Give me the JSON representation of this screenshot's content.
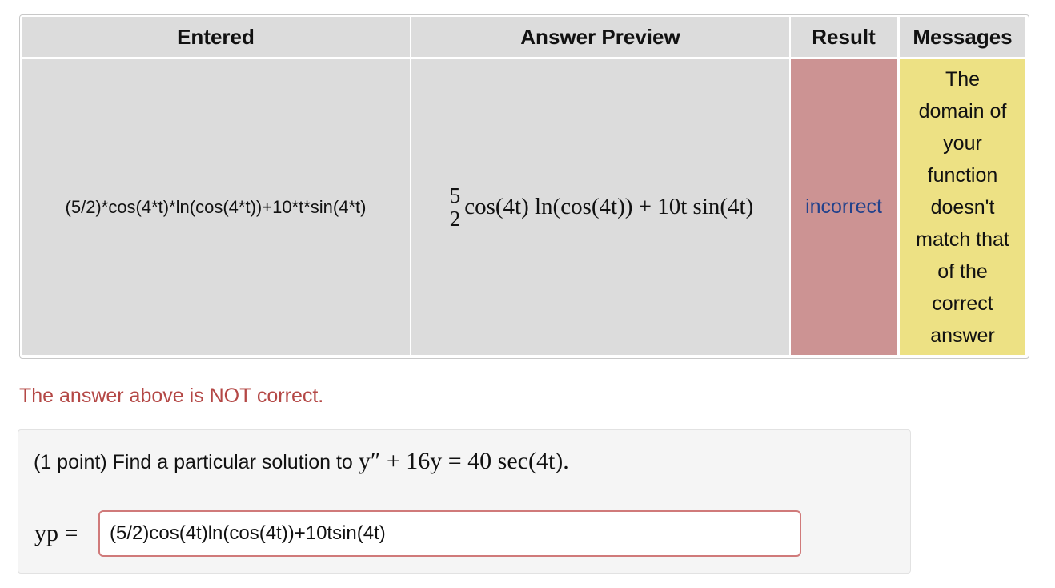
{
  "table": {
    "headers": [
      "Entered",
      "Answer Preview",
      "Result",
      "Messages"
    ],
    "row": {
      "entered": "(5/2)*cos(4*t)*ln(cos(4*t))+10*t*sin(4*t)",
      "preview": {
        "frac_num": "5",
        "frac_den": "2",
        "rest": "cos(4t) ln(cos(4t)) + 10t sin(4t)"
      },
      "result": "incorrect",
      "message_lines": [
        "The",
        "domain of",
        "your",
        "function",
        "doesn't",
        "match that",
        "of the",
        "correct",
        "answer"
      ]
    }
  },
  "status": "The answer above is NOT correct.",
  "problem": {
    "prompt": "(1 point) Find a particular solution to",
    "equation": "y″ + 16y = 40 sec(4t).",
    "answer_label": "yp =",
    "answer_value": "(5/2)cos(4t)ln(cos(4t))+10tsin(4t)"
  },
  "colors": {
    "header_bg": "#dcdcdc",
    "incorrect_bg": "#cc9393",
    "message_bg": "#ede184",
    "incorrect_text": "#22428c",
    "status_text": "#b44846",
    "input_border": "#d07a7a"
  }
}
